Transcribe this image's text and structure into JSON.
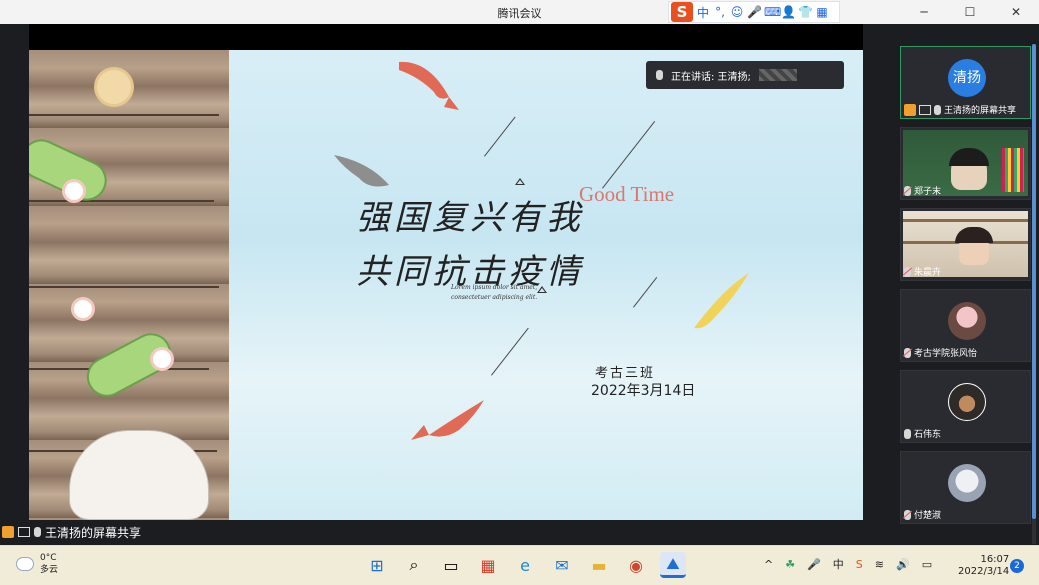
{
  "window": {
    "title": "腾讯会议",
    "controls": [
      "─",
      "☐",
      "✕"
    ]
  },
  "ime": {
    "logo": "S",
    "items": [
      "中",
      "°,",
      "☺",
      "🎤",
      "⌨",
      "👤",
      "👕",
      "▦"
    ]
  },
  "presentation": {
    "speaker_label": "正在讲话: 王清扬;",
    "title_line1": "强国复兴有我",
    "title_line2": "共同抗击疫情",
    "accent_text": "Good Time",
    "lorem": "Lorem ipsum dolor sit amet, consectetuer adipiscing elit.",
    "class_name": "考古三班",
    "date": "2022年3月14日"
  },
  "participants": [
    {
      "avatar_text": "清扬",
      "name": "王清扬的屏幕共享",
      "avatar_color": "#2a7de1",
      "active": true,
      "kind": "avatar"
    },
    {
      "name": "郑子末",
      "kind": "video-green"
    },
    {
      "name": "朱晨卉",
      "kind": "video-shelf"
    },
    {
      "name": "考古学院张风怡",
      "kind": "face-pink"
    },
    {
      "name": "石伟东",
      "kind": "face-cowboy"
    },
    {
      "name": "付楚淑",
      "kind": "face-gray"
    }
  ],
  "share_bar": {
    "label": "王清扬的屏幕共享"
  },
  "taskbar": {
    "weather_temp": "0°C",
    "weather_desc": "多云",
    "apps": [
      "⊞",
      "⌕",
      "▭",
      "▦",
      "e",
      "✉",
      "▬",
      "◉",
      "⛰"
    ],
    "tray": [
      "^",
      "☘",
      "🎤",
      "中",
      "S",
      "≋",
      "🔊",
      "▭"
    ],
    "time": "16:07",
    "date": "2022/3/14",
    "notifications": "2"
  }
}
